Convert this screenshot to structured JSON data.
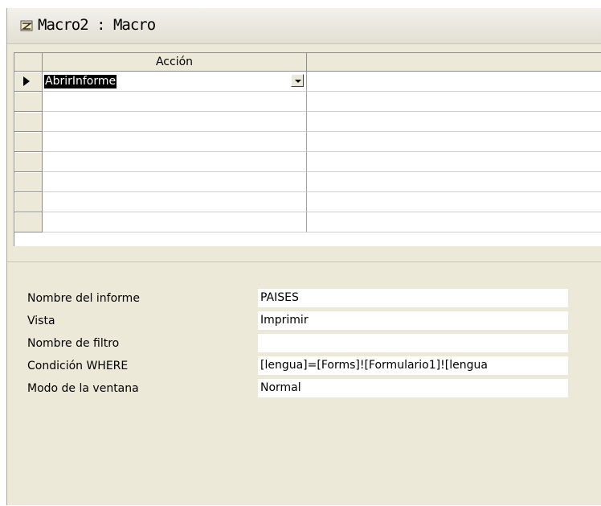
{
  "window": {
    "title": "Macro2 : Macro"
  },
  "grid": {
    "columns": [
      "Acción",
      ""
    ],
    "rows": [
      {
        "action": "AbrirInforme",
        "comment": ""
      },
      {
        "action": "",
        "comment": ""
      },
      {
        "action": "",
        "comment": ""
      },
      {
        "action": "",
        "comment": ""
      },
      {
        "action": "",
        "comment": ""
      },
      {
        "action": "",
        "comment": ""
      },
      {
        "action": "",
        "comment": ""
      },
      {
        "action": "",
        "comment": ""
      }
    ]
  },
  "properties": [
    {
      "label": "Nombre del informe",
      "value": "PAISES"
    },
    {
      "label": "Vista",
      "value": "Imprimir"
    },
    {
      "label": "Nombre de filtro",
      "value": ""
    },
    {
      "label": "Condición WHERE",
      "value": "[lengua]=[Forms]![Formulario1]![lengua"
    },
    {
      "label": "Modo de la ventana",
      "value": "Normal"
    }
  ]
}
